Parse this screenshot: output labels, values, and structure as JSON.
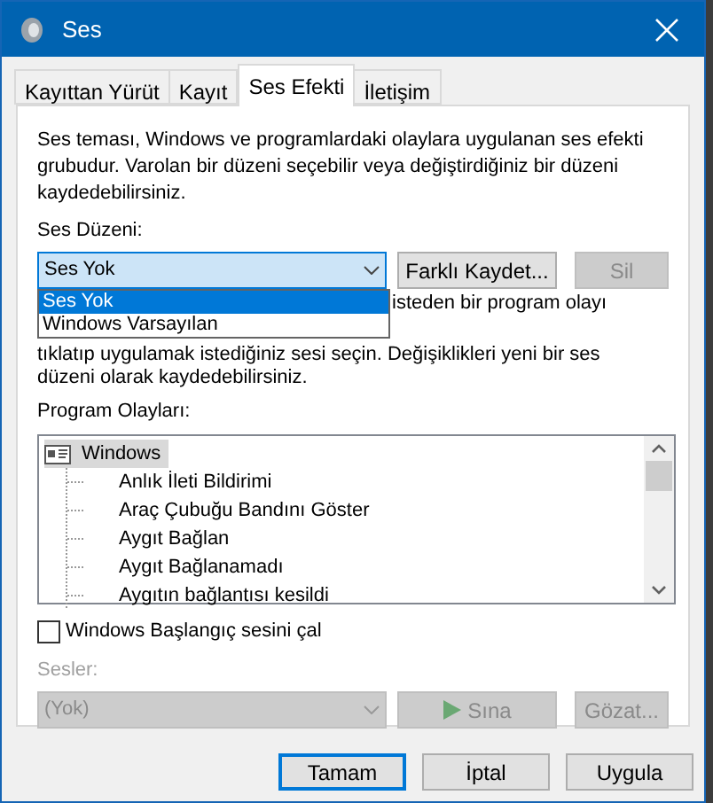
{
  "window": {
    "title": "Ses"
  },
  "tabs": [
    {
      "label": "Kayıttan Yürüt",
      "selected": false
    },
    {
      "label": "Kayıt",
      "selected": false
    },
    {
      "label": "Ses Efekti",
      "selected": true
    },
    {
      "label": "İletişim",
      "selected": false
    }
  ],
  "intro": "Ses teması, Windows ve programlardaki olaylara uygulanan ses efekti grubudur. Varolan bir düzeni seçebilir veya değiştirdiğiniz bir düzeni kaydedebilirsiniz.",
  "scheme": {
    "label": "Ses Düzeni:",
    "value": "Ses Yok",
    "save_as": {
      "label": "Farklı Kaydet...",
      "disabled": false
    },
    "delete": {
      "label": "Sil",
      "disabled": true
    },
    "options": [
      {
        "label": "Ses Yok",
        "selected": true
      },
      {
        "label": "Windows Varsayılan",
        "selected": false
      }
    ]
  },
  "hint_lines": [
    "isteden bir program olayı",
    "tıklatıp uygulamak istediğiniz sesi seçin. Değişiklikleri yeni bir ses",
    "düzeni olarak kaydedebilirsiniz."
  ],
  "events": {
    "label": "Program Olayları:",
    "groups": [
      {
        "label": "Windows",
        "selected": true,
        "children": [
          {
            "label": "Anlık İleti Bildirimi"
          },
          {
            "label": "Araç Çubuğu Bandını Göster"
          },
          {
            "label": "Aygıt Bağlan"
          },
          {
            "label": "Aygıt Bağlanamadı"
          },
          {
            "label": "Aygıtın bağlantısı kesildi"
          }
        ]
      }
    ]
  },
  "startup_sound": {
    "label": "Windows Başlangıç sesini çal",
    "checked": false
  },
  "sounds": {
    "label": "Sesler:",
    "value": "(Yok)",
    "disabled": true,
    "test": {
      "label": "Sına",
      "disabled": true
    },
    "browse": {
      "label": "Gözat...",
      "disabled": true
    }
  },
  "buttons": [
    {
      "label": "Tamam",
      "default": true
    },
    {
      "label": "İptal",
      "default": false
    },
    {
      "label": "Uygula",
      "default": false
    }
  ]
}
